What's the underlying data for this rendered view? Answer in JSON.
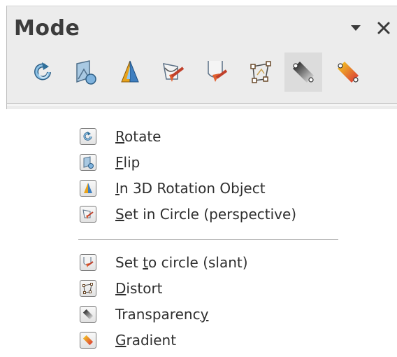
{
  "toolbar": {
    "title": "Mode",
    "menu_icon": "dropdown-triangle-icon",
    "close_icon": "close-icon",
    "icons": [
      {
        "name": "rotate",
        "icon": "rotate-icon"
      },
      {
        "name": "flip",
        "icon": "flip-icon"
      },
      {
        "name": "3d-rotation",
        "icon": "3d-rotation-object-icon"
      },
      {
        "name": "set-in-circle-perspective",
        "icon": "set-in-circle-perspective-icon"
      },
      {
        "name": "set-to-circle-slant",
        "icon": "set-to-circle-slant-icon"
      },
      {
        "name": "distort",
        "icon": "distort-icon"
      },
      {
        "name": "transparency",
        "icon": "transparency-icon",
        "active": true
      },
      {
        "name": "gradient",
        "icon": "gradient-icon"
      }
    ]
  },
  "menu": {
    "items": [
      {
        "label": "Rotate",
        "pre": "",
        "acc": "R",
        "post": "otate",
        "icon": "rotate-icon"
      },
      {
        "label": "Flip",
        "pre": "",
        "acc": "F",
        "post": "lip",
        "icon": "flip-icon"
      },
      {
        "label": "In 3D Rotation Object",
        "pre": "",
        "acc": "I",
        "post": "n 3D Rotation Object",
        "icon": "3d-rotation-object-icon"
      },
      {
        "label": "Set in Circle (perspective)",
        "pre": "",
        "acc": "S",
        "post": "et in Circle (perspective)",
        "icon": "set-in-circle-perspective-icon"
      },
      {
        "label": "Set to circle (slant)",
        "pre": "Set ",
        "acc": "t",
        "post": "o circle (slant)",
        "icon": "set-to-circle-slant-icon"
      },
      {
        "label": "Distort",
        "pre": "",
        "acc": "D",
        "post": "istort",
        "icon": "distort-icon"
      },
      {
        "label": "Transparency",
        "pre": "Transparenc",
        "acc": "y",
        "post": "",
        "icon": "transparency-icon"
      },
      {
        "label": "Gradient",
        "pre": "",
        "acc": "G",
        "post": "radient",
        "icon": "gradient-icon"
      }
    ]
  },
  "colors": {
    "toolbar_bg": "#ececec",
    "active_bg": "#dcdcdc",
    "text": "#2e2e2e"
  }
}
